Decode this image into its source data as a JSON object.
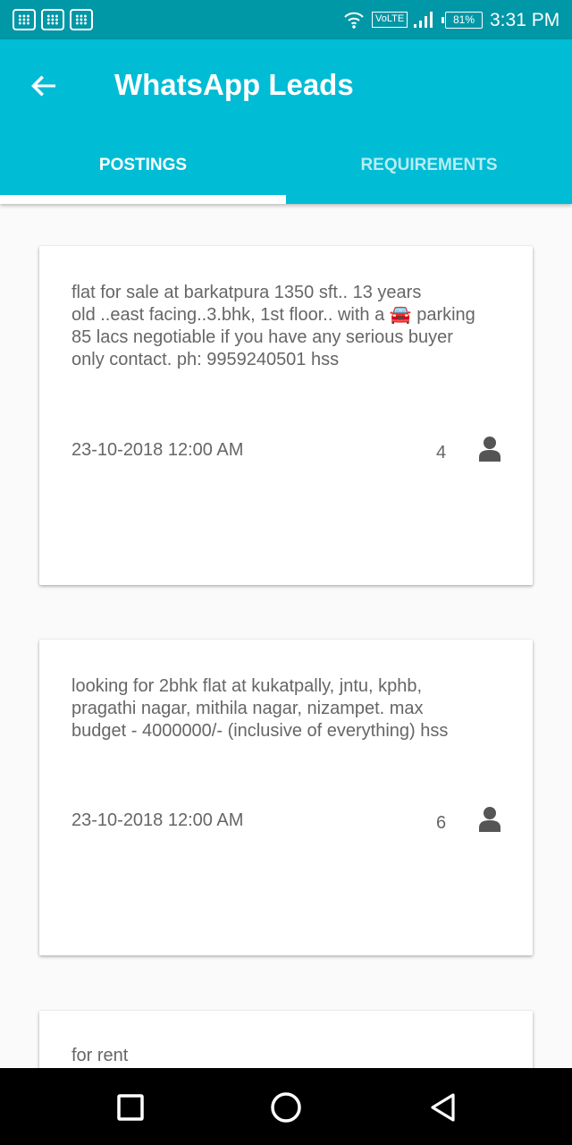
{
  "status_bar": {
    "volte": "VoLTE",
    "battery": "81%",
    "time": "3:31 PM",
    "icons": [
      "app-notification-icon",
      "app-notification-icon",
      "app-notification-icon",
      "wifi-icon",
      "signal-icon",
      "battery-icon"
    ]
  },
  "app_bar": {
    "title": "WhatsApp Leads",
    "back_icon": "arrow-back-icon",
    "background": "#00bcd4"
  },
  "tabs": [
    {
      "label": "POSTINGS",
      "active": true
    },
    {
      "label": "REQUIREMENTS",
      "active": false
    }
  ],
  "cards": [
    {
      "lines": [
        "flat for sale at barkatpura 1350 sft.. 13 years",
        "old ..east facing..3.bhk, 1st floor.. with a 🚘 parking",
        "85 lacs negotiable if you have any serious buyer",
        "only contact. ph: 9959240501  hss"
      ],
      "date": "23-10-2018  12:00 AM",
      "count": "4",
      "icon": "person-icon"
    },
    {
      "lines": [
        "looking for 2bhk flat at kukatpally, jntu, kphb,",
        "pragathi nagar, mithila nagar, nizampet. max",
        "budget - 4000000/- (inclusive of everything)  hss"
      ],
      "date": "23-10-2018  12:00 AM",
      "count": "6",
      "icon": "person-icon"
    },
    {
      "lines": [
        "for rent"
      ]
    }
  ],
  "nav_bar": {
    "icons": [
      "recents-square-icon",
      "home-circle-icon",
      "back-triangle-icon"
    ]
  }
}
